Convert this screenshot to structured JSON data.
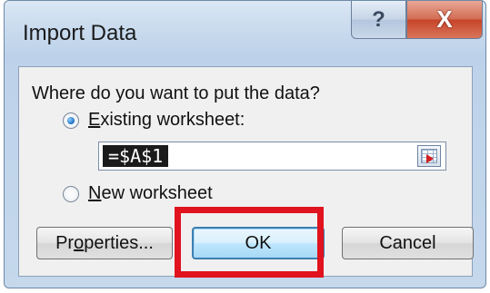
{
  "dialog": {
    "title": "Import Data",
    "help_label": "?",
    "close_label": "X"
  },
  "body": {
    "question": "Where do you want to put the data?",
    "options": [
      {
        "label_accel": "E",
        "label_rest": "xisting worksheet:",
        "selected": true
      },
      {
        "label_accel": "N",
        "label_rest": "ew worksheet",
        "selected": false
      }
    ],
    "range_value": "=$A$1"
  },
  "buttons": {
    "properties_pre": "Pr",
    "properties_accel": "o",
    "properties_post": "perties...",
    "ok": "OK",
    "cancel": "Cancel"
  },
  "colors": {
    "highlight": "#e0131e",
    "accent": "#3c7fb1"
  },
  "icons": {
    "collapse": "collapse-dialog-icon",
    "radio": "radio-icon"
  }
}
